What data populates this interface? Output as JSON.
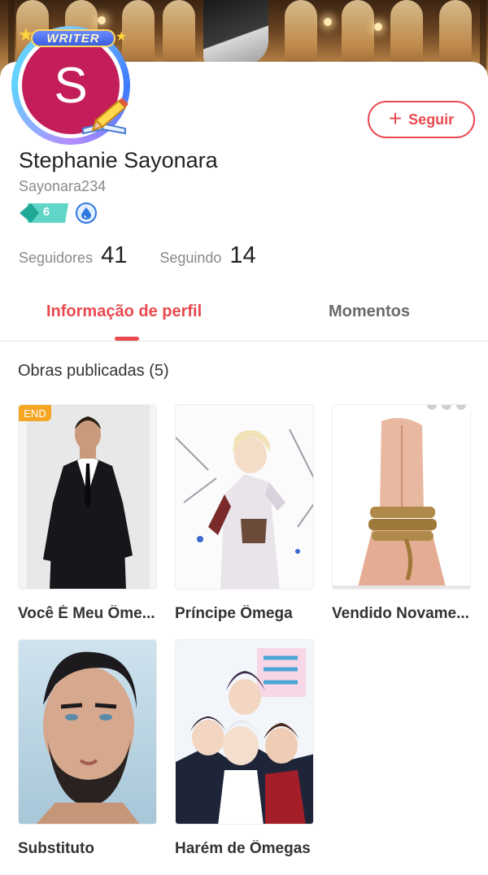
{
  "profile": {
    "writer_badge": "WRITER",
    "avatar_letter": "S",
    "name": "Stephanie Sayonara",
    "username": "Sayonara234",
    "level": "6",
    "follow_label": "Seguir"
  },
  "stats": {
    "followers_label": "Seguidores",
    "followers_value": "41",
    "following_label": "Seguindo",
    "following_value": "14"
  },
  "tabs": [
    {
      "label": "Informação de perfil",
      "active": true
    },
    {
      "label": "Momentos",
      "active": false
    }
  ],
  "works": {
    "heading": "Obras publicadas (5)",
    "items": [
      {
        "title": "Você É Meu Ôme...",
        "badge": "END",
        "cover": "man-in-suit"
      },
      {
        "title": "Príncipe Ômega",
        "cover": "anime-prince"
      },
      {
        "title": "Vendido Novame...",
        "cover": "tied-hands"
      },
      {
        "title": "Substituto",
        "cover": "bearded-man"
      },
      {
        "title": "Harém de Ômegas",
        "cover": "anime-group"
      }
    ]
  },
  "colors": {
    "accent": "#e84a4f",
    "avatar_bg": "#c41e5a",
    "end_badge": "#f5a623",
    "level_badge": "#2ec4b6"
  }
}
